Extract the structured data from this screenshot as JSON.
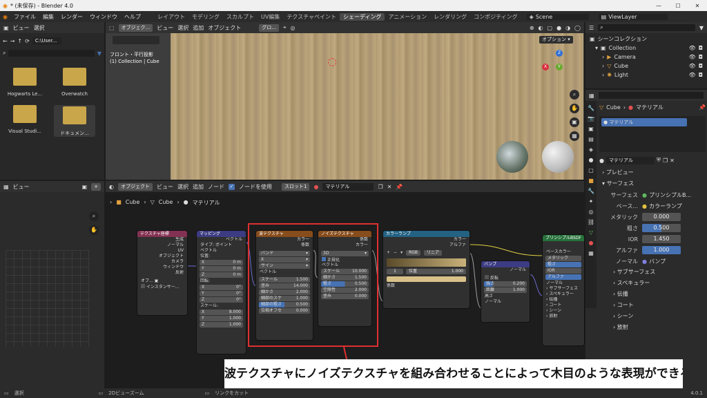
{
  "window": {
    "title": "* (未保存) - Blender 4.0",
    "min": "—",
    "max": "☐",
    "close": "✕"
  },
  "menu": [
    "ファイル",
    "編集",
    "レンダー",
    "ウィンドウ",
    "ヘルプ"
  ],
  "workspaces": [
    "レイアウト",
    "モデリング",
    "スカルプト",
    "UV編集",
    "テクスチャペイント",
    "シェーディング",
    "アニメーション",
    "レンダリング",
    "コンポジティング"
  ],
  "active_workspace": "シェーディング",
  "scene": "Scene",
  "view_layer": "ViewLayer",
  "file_browser": {
    "menu": [
      "ビュー",
      "選択"
    ],
    "path": "C:\\User...",
    "folders": [
      "Hogwarts Le...",
      "Overwatch",
      "Visual Studi...",
      "ドキュメン..."
    ]
  },
  "viewport": {
    "mode": "オブジェク...",
    "menu": [
      "ビュー",
      "選択",
      "追加",
      "オブジェクト"
    ],
    "transform": "グロ...",
    "view_name": "フロント・平行投影",
    "collection_info": "(1) Collection | Cube",
    "options": "オプション ▾",
    "axes": [
      "Z",
      "Y",
      "X"
    ]
  },
  "outliner": {
    "title": "シーンコレクション",
    "items": [
      "Collection",
      "Camera",
      "Cube",
      "Light"
    ],
    "search_placeholder": ""
  },
  "properties": {
    "object": "Cube",
    "material_tab": "マテリアル",
    "slot": "マテリアル",
    "material_name": "マテリアル",
    "sections": {
      "preview": "プレビュー",
      "surface": "サーフェス",
      "surface_label": "サーフェス",
      "surface_value": "プリンシプルB...",
      "base_color_label": "ベース...",
      "base_color_value": "カラーランプ",
      "metallic_label": "メタリック",
      "metallic_value": "0.000",
      "roughness_label": "粗さ",
      "roughness_value": "0.500",
      "ior_label": "IOR",
      "ior_value": "1.450",
      "alpha_label": "アルファ",
      "alpha_value": "1.000",
      "normal_label": "ノーマル",
      "normal_value": "バンプ",
      "subsurface": "サブサーフェス",
      "specular": "スペキュラー",
      "transmission": "伝播",
      "coat": "コート",
      "sheen": "シーン",
      "emission": "放射"
    }
  },
  "uv_editor": {
    "menu": "ビュー"
  },
  "node_editor": {
    "mode": "オブジェクト",
    "menu": [
      "ビュー",
      "選択",
      "追加",
      "ノード"
    ],
    "use_nodes": "ノードを使用",
    "slot": "スロット1",
    "material": "マテリアル",
    "breadcrumb": [
      "Cube",
      "Cube",
      "マテリアル"
    ]
  },
  "nodes": {
    "texcoord": {
      "title": "テクスチャ座標",
      "outs": [
        "生成",
        "ノーマル",
        "UV",
        "オブジェクト",
        "カメラ",
        "ウィンドウ",
        "反射"
      ],
      "obj_label": "オブ...",
      "instancer": "インスタンサー..."
    },
    "mapping": {
      "title": "マッピング",
      "out": "ベクトル",
      "type_label": "タイプ:",
      "type": "ポイント",
      "vector": "ベクトル",
      "location": "位置:",
      "rotation": "回転:",
      "scale": "スケール:",
      "loc": [
        [
          "X",
          "0 m"
        ],
        [
          "Y",
          "0 m"
        ],
        [
          "Z",
          "0 m"
        ]
      ],
      "rot": [
        [
          "X",
          "0°"
        ],
        [
          "Y",
          "0°"
        ],
        [
          "Z",
          "0°"
        ]
      ],
      "scl": [
        [
          "X",
          "8.000"
        ],
        [
          "Y",
          "1.000"
        ],
        [
          "Z",
          "1.000"
        ]
      ]
    },
    "wave": {
      "title": "波テクスチャ",
      "outs": [
        "カラー",
        "係数"
      ],
      "d1": "バンド",
      "d2": "X",
      "d3": "サイン",
      "vector": "ベクトル",
      "fields": [
        [
          "スケール",
          "1.500"
        ],
        [
          "歪み",
          "14.000"
        ],
        [
          "細かさ",
          "2.000"
        ],
        [
          "細部のスケ",
          "1.000"
        ],
        [
          "細部の粗さ",
          "0.500"
        ],
        [
          "位相オフセ",
          "0.000"
        ]
      ]
    },
    "noise": {
      "title": "ノイズテクスチャ",
      "outs": [
        "係数",
        "カラー"
      ],
      "dim": "3D",
      "normalize": "正規化",
      "vector": "ベクトル",
      "fields": [
        [
          "スケール",
          "10.000"
        ],
        [
          "細かさ",
          "1.500"
        ],
        [
          "粗さ",
          "0.500"
        ],
        [
          "空隙性",
          "2.000"
        ],
        [
          "歪み",
          "0.000"
        ]
      ]
    },
    "ramp": {
      "title": "カラーランプ",
      "outs": [
        "カラー",
        "アルファ"
      ],
      "mode": "RGB",
      "interp": "リニア",
      "index": "1",
      "pos_label": "位置",
      "pos": "1.000",
      "in": "係数"
    },
    "bump": {
      "title": "バンプ",
      "out": "ノーマル",
      "invert": "反転",
      "strength_label": "強さ",
      "strength": "0.200",
      "distance_label": "距離",
      "distance": "1.000",
      "height": "高さ",
      "normal": "ノーマル"
    },
    "bsdf": {
      "title": "プリンシプルBSDF",
      "ins": [
        "ベースカラー",
        "メタリック",
        "粗さ",
        "IOR",
        "アルファ",
        "ノーマル"
      ],
      "subs": [
        "サブサーフェス",
        "スペキュラー",
        "伝播",
        "コート",
        "シーン",
        "放射"
      ]
    }
  },
  "caption": "波テクスチャにノイズテクスチャを組み合わせることによって木目のような表現ができる",
  "status": {
    "select": "選択",
    "zoom": "2Dビューズーム",
    "cut": "リンクをカット",
    "version": "4.0.1"
  },
  "colors": {
    "accent": "#4772b3",
    "highlight": "#e03030",
    "wood": "#b9a27a"
  }
}
